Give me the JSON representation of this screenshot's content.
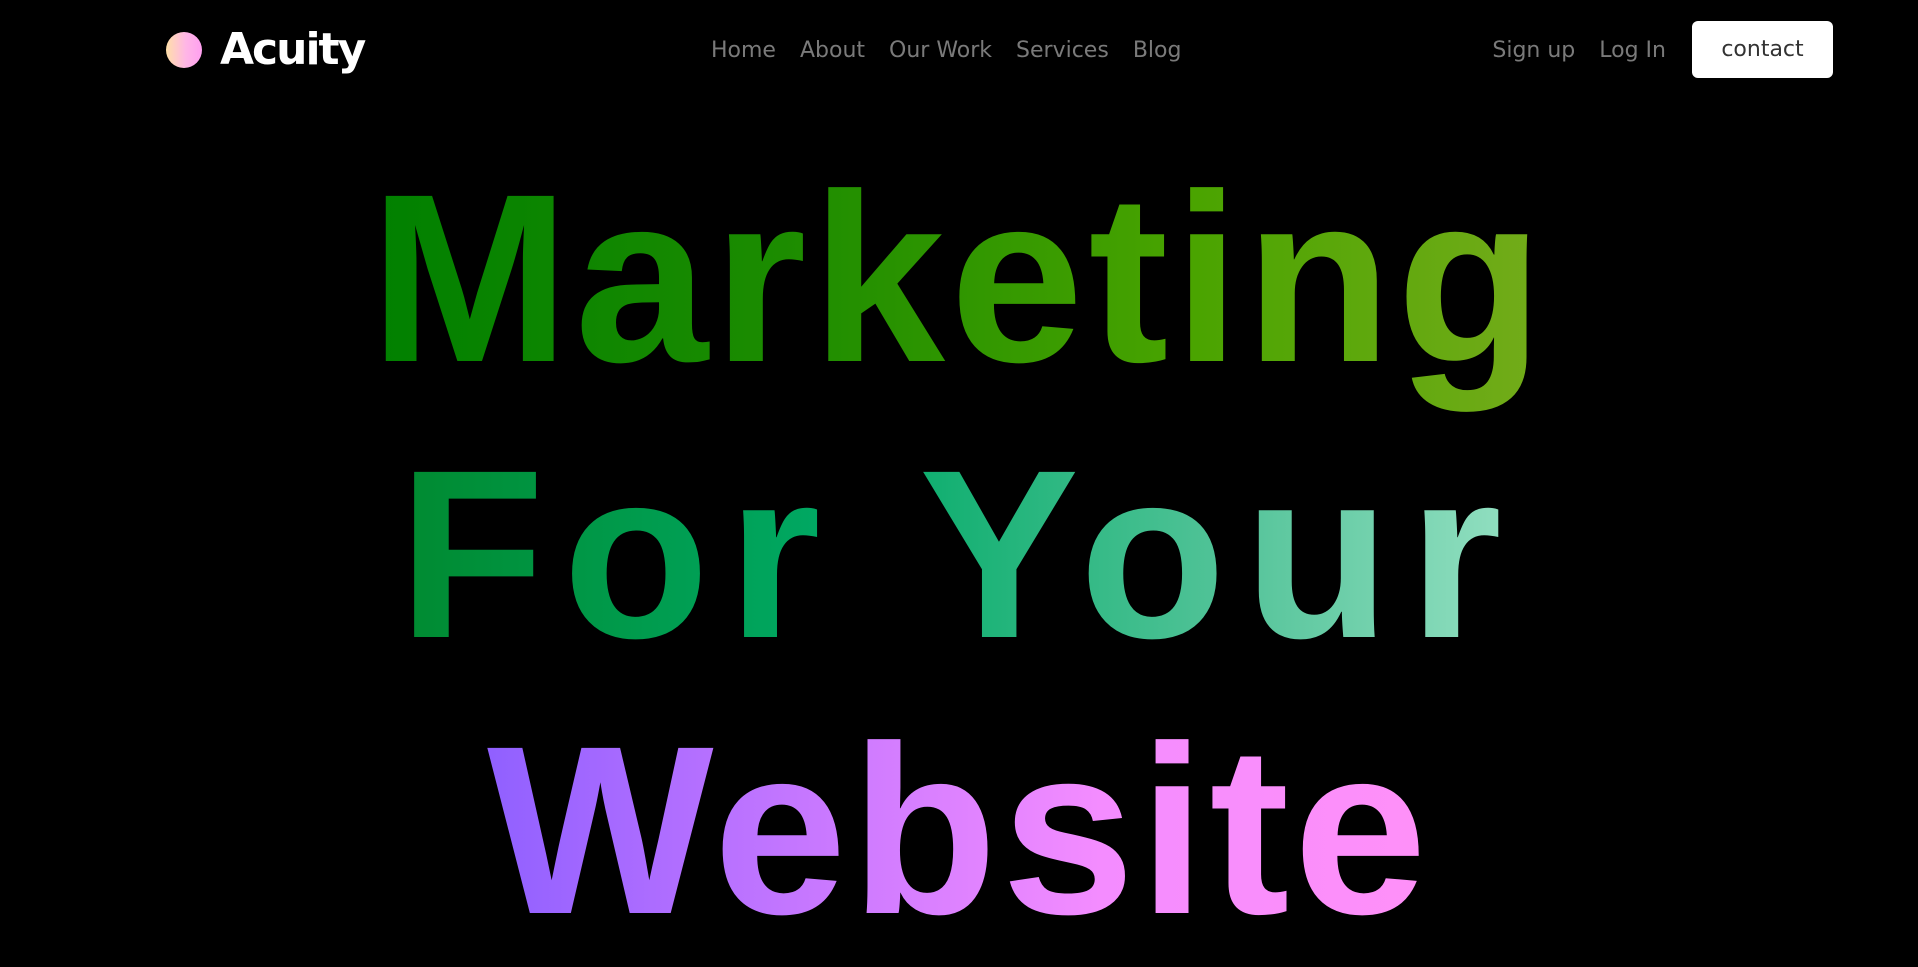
{
  "brand": {
    "name": "Acuity"
  },
  "nav": {
    "links": [
      "Home",
      "About",
      "Our Work",
      "Services",
      "Blog"
    ],
    "sign_up": "Sign up",
    "log_in": "Log In",
    "contact": "contact"
  },
  "hero": {
    "line1": "Marketing",
    "line2": "For Your",
    "line3": "Website"
  },
  "colors": {
    "background": "#000000",
    "line1_gradient": [
      "#008000",
      "#74ac1a"
    ],
    "line2_gradient": [
      "#008a30",
      "#94e0c2"
    ],
    "line3_gradient": [
      "#9060ff",
      "#ff90f8"
    ],
    "nav_text": "#7a7a7a"
  }
}
